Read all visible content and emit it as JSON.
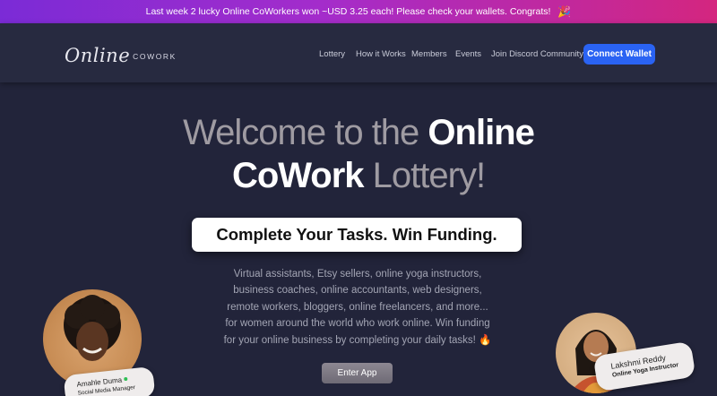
{
  "banner": {
    "text": "Last week 2 lucky Online CoWorkers won ~USD 3.25 each! Please check your wallets. Congrats!",
    "icon": "party-popper-icon",
    "emoji": "🎉"
  },
  "logo": {
    "script": "Online",
    "caps": "COWORK"
  },
  "nav": {
    "items": [
      "Lottery",
      "How it Works",
      "Members",
      "Events",
      "Join Discord Community"
    ],
    "connect_label": "Connect Wallet"
  },
  "hero": {
    "line1_muted": "Welcome to the ",
    "line1_strong": "Online",
    "line2_strong": "CoWork",
    "line2_muted": " Lottery!",
    "tagline": "Complete Your Tasks. Win Funding.",
    "description": "Virtual assistants, Etsy sellers, online yoga instructors, business coaches, online accountants, web designers, remote workers, bloggers, online freelancers, and more... for women around the world who work online. Win funding for your online business by completing your daily tasks! 🔥",
    "enter_label": "Enter App"
  },
  "members": [
    {
      "name": "Amahle Duma",
      "role": "Social Media Manager",
      "status": "online"
    },
    {
      "name": "Lakshmi Reddy",
      "role": "Online Yoga Instructor"
    }
  ],
  "colors": {
    "background": "#22243a",
    "accent": "#2a63f3",
    "banner_start": "#7b2bd6",
    "banner_end": "#d4267f"
  }
}
